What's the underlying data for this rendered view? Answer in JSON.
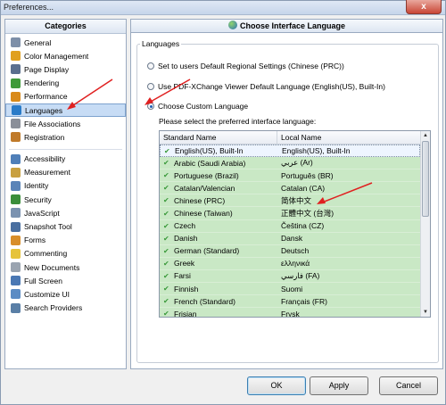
{
  "window": {
    "title": "Preferences...",
    "close_label": "x"
  },
  "sidebar": {
    "header": "Categories",
    "items": [
      {
        "label": "General",
        "icon": "general-icon",
        "color": "#7d8fa8"
      },
      {
        "label": "Color Management",
        "icon": "color-management-icon",
        "color": "#e0a020"
      },
      {
        "label": "Page Display",
        "icon": "page-display-icon",
        "color": "#5a6f8e"
      },
      {
        "label": "Rendering",
        "icon": "rendering-icon",
        "color": "#3f9a3a"
      },
      {
        "label": "Performance",
        "icon": "performance-icon",
        "color": "#d98a1a"
      },
      {
        "label": "Languages",
        "icon": "globe-icon",
        "color": "#2a7bc8",
        "selected": true
      },
      {
        "label": "File Associations",
        "icon": "file-associations-icon",
        "color": "#8a8f99"
      },
      {
        "label": "Registration",
        "icon": "registration-icon",
        "color": "#c07a2a"
      },
      {
        "sep": true
      },
      {
        "label": "Accessibility",
        "icon": "accessibility-icon",
        "color": "#4f7fb8"
      },
      {
        "label": "Measurement",
        "icon": "measurement-icon",
        "color": "#c8a040"
      },
      {
        "label": "Identity",
        "icon": "identity-icon",
        "color": "#5a84b8"
      },
      {
        "label": "Security",
        "icon": "security-icon",
        "color": "#3b8e3b"
      },
      {
        "label": "JavaScript",
        "icon": "javascript-icon",
        "color": "#7a92b0"
      },
      {
        "label": "Snapshot Tool",
        "icon": "snapshot-icon",
        "color": "#4a6fa0"
      },
      {
        "label": "Forms",
        "icon": "forms-icon",
        "color": "#d88e2a"
      },
      {
        "label": "Commenting",
        "icon": "commenting-icon",
        "color": "#e6c33a"
      },
      {
        "label": "New Documents",
        "icon": "new-documents-icon",
        "color": "#9aa4b0"
      },
      {
        "label": "Full Screen",
        "icon": "full-screen-icon",
        "color": "#4a78b4"
      },
      {
        "label": "Customize UI",
        "icon": "customize-ui-icon",
        "color": "#5c8cc4"
      },
      {
        "label": "Search Providers",
        "icon": "search-providers-icon",
        "color": "#5a7fa6"
      }
    ]
  },
  "content": {
    "title": "Choose Interface Language",
    "group_label": "Languages",
    "options": [
      {
        "label": "Set to users Default Regional Settings (Chinese (PRC))",
        "checked": false
      },
      {
        "label": "Use PDF-XChange Viewer Default Language (English(US), Built-In)",
        "checked": false
      },
      {
        "label": "Choose Custom Language",
        "checked": true
      }
    ],
    "prompt": "Please select the preferred interface language:",
    "list": {
      "col1": "Standard Name",
      "col2": "Local Name",
      "rows": [
        {
          "std": "English(US), Built-In",
          "local": "English(US), Built-In",
          "selected": true
        },
        {
          "std": "Arabic (Saudi Arabia)",
          "local": "عربي (Ar)"
        },
        {
          "std": "Portuguese (Brazil)",
          "local": "Português (BR)"
        },
        {
          "std": "Catalan/Valencian",
          "local": "Catalan (CA)"
        },
        {
          "std": "Chinese (PRC)",
          "local": "简体中文"
        },
        {
          "std": "Chinese (Taiwan)",
          "local": "正體中文 (台灣)"
        },
        {
          "std": "Czech",
          "local": "Čeština (CZ)"
        },
        {
          "std": "Danish",
          "local": "Dansk"
        },
        {
          "std": "German (Standard)",
          "local": "Deutsch"
        },
        {
          "std": "Greek",
          "local": "ελληνικά"
        },
        {
          "std": "Farsi",
          "local": "فارسي (FA)"
        },
        {
          "std": "Finnish",
          "local": "Suomi"
        },
        {
          "std": "French (Standard)",
          "local": "Français (FR)"
        },
        {
          "std": "Frisian",
          "local": "Frysk"
        }
      ]
    }
  },
  "buttons": {
    "ok": "OK",
    "apply": "Apply",
    "cancel": "Cancel"
  },
  "colors": {
    "accent": "#2a7bc8",
    "list_row": "#c9e8c5",
    "annotation_arrow": "#e02020"
  }
}
